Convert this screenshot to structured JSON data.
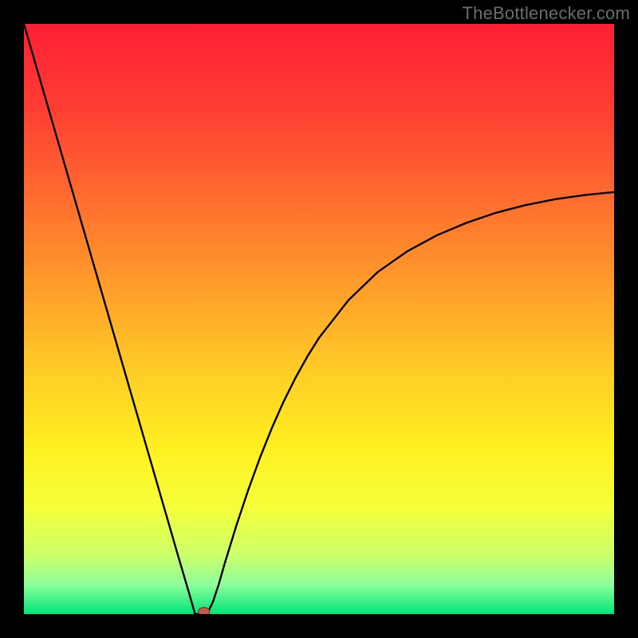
{
  "watermark": "TheBottlenecker.com",
  "chart_data": {
    "type": "line",
    "title": "",
    "xlabel": "",
    "ylabel": "",
    "xlim": [
      0,
      100
    ],
    "ylim": [
      0,
      100
    ],
    "x": [
      0,
      2,
      4,
      6,
      8,
      10,
      12,
      14,
      16,
      18,
      20,
      22,
      24,
      26,
      28,
      29,
      30,
      31,
      32,
      33,
      34,
      36,
      38,
      40,
      42,
      44,
      46,
      48,
      50,
      55,
      60,
      65,
      70,
      75,
      80,
      85,
      90,
      95,
      100
    ],
    "values": [
      100,
      93.1,
      86.2,
      79.3,
      72.4,
      65.5,
      58.6,
      51.7,
      44.8,
      37.9,
      31.0,
      24.1,
      17.2,
      10.3,
      3.5,
      0.0,
      0.0,
      0.0,
      2.0,
      5.0,
      8.5,
      15.0,
      21.0,
      26.5,
      31.5,
      36.0,
      40.0,
      43.6,
      46.8,
      53.2,
      58.0,
      61.5,
      64.2,
      66.3,
      68.0,
      69.3,
      70.3,
      71.0,
      71.5
    ],
    "marker": {
      "x": 30.5,
      "y": 0.4
    },
    "gradient_stops": [
      {
        "offset": 0.0,
        "color": "#ff1f35"
      },
      {
        "offset": 0.14,
        "color": "#ff3d33"
      },
      {
        "offset": 0.3,
        "color": "#ff6e2f"
      },
      {
        "offset": 0.46,
        "color": "#ffa22a"
      },
      {
        "offset": 0.6,
        "color": "#ffd026"
      },
      {
        "offset": 0.72,
        "color": "#fff021"
      },
      {
        "offset": 0.82,
        "color": "#f4ff3a"
      },
      {
        "offset": 0.9,
        "color": "#ccff6a"
      },
      {
        "offset": 0.95,
        "color": "#8dff9a"
      },
      {
        "offset": 1.0,
        "color": "#00e57a"
      }
    ]
  }
}
